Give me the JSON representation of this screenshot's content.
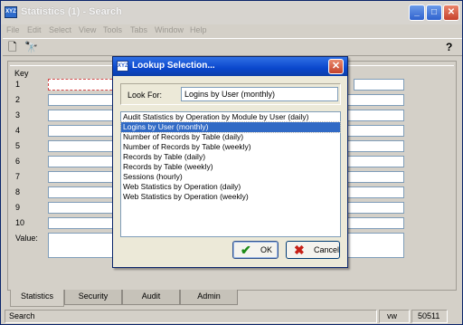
{
  "window": {
    "title": "Statistics (1) - Search",
    "icon_text": "XYZ",
    "minimize": "_",
    "maximize": "□",
    "close": "✕"
  },
  "menu": [
    "File",
    "Edit",
    "Select",
    "View",
    "Tools",
    "Tabs",
    "Window",
    "Help"
  ],
  "toolbar": {
    "new_icon": "🗋",
    "find_icon": "🔭",
    "help_icon": "?"
  },
  "panel": {
    "key_header": "Key",
    "rows": [
      "1",
      "2",
      "3",
      "4",
      "5",
      "6",
      "7",
      "8",
      "9",
      "10"
    ],
    "value_label": "Value:"
  },
  "tabs": [
    "Statistics",
    "Security",
    "Audit",
    "Admin"
  ],
  "statusbar": {
    "mode": "Search",
    "flag": "vw",
    "number": "50511"
  },
  "dialog": {
    "title": "Lookup Selection...",
    "look_for_label": "Look For:",
    "look_for_value": "Logins by User (monthly)",
    "items": [
      "Audit Statistics by Operation by Module by User (daily)",
      "Logins by User (monthly)",
      "Number of Records by Table (daily)",
      "Number of Records by Table (weekly)",
      "Records by Table (daily)",
      "Records by Table (weekly)",
      "Sessions (hourly)",
      "Web Statistics by Operation (daily)",
      "Web Statistics by Operation (weekly)"
    ],
    "selected_index": 1,
    "ok_label": "OK",
    "cancel_label": "Cancel",
    "ok_icon": "✔",
    "cancel_icon": "✖"
  }
}
